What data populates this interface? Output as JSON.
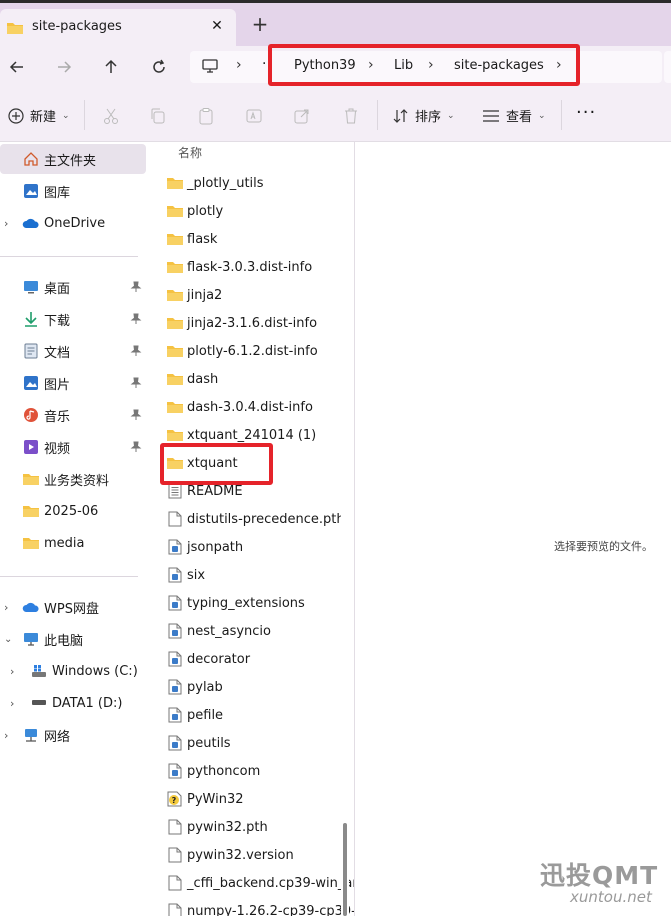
{
  "window": {
    "tab_title": "site-packages"
  },
  "address": {
    "crumbs": [
      "Python39",
      "Lib",
      "site-packages"
    ]
  },
  "toolbar": {
    "new_label": "新建",
    "sort_label": "排序",
    "view_label": "查看"
  },
  "sidebar": {
    "home": "主文件夹",
    "gallery": "图库",
    "onedrive": "OneDrive",
    "quick": [
      {
        "label": "桌面",
        "icon": "desktop-icon"
      },
      {
        "label": "下载",
        "icon": "download-icon"
      },
      {
        "label": "文档",
        "icon": "documents-icon"
      },
      {
        "label": "图片",
        "icon": "pictures-icon"
      },
      {
        "label": "音乐",
        "icon": "music-icon"
      },
      {
        "label": "视频",
        "icon": "videos-icon"
      }
    ],
    "folders": [
      "业务类资料",
      "2025-06",
      "media"
    ],
    "wps": "WPS网盘",
    "thispc": "此电脑",
    "drive_c": "Windows (C:)",
    "drive_d": "DATA1 (D:)",
    "network": "网络"
  },
  "filelist": {
    "column_name": "名称",
    "items": [
      {
        "name": "_plotly_utils",
        "type": "folder"
      },
      {
        "name": "plotly",
        "type": "folder"
      },
      {
        "name": "flask",
        "type": "folder"
      },
      {
        "name": "flask-3.0.3.dist-info",
        "type": "folder"
      },
      {
        "name": "jinja2",
        "type": "folder"
      },
      {
        "name": "jinja2-3.1.6.dist-info",
        "type": "folder"
      },
      {
        "name": "plotly-6.1.2.dist-info",
        "type": "folder"
      },
      {
        "name": "dash",
        "type": "folder"
      },
      {
        "name": "dash-3.0.4.dist-info",
        "type": "folder"
      },
      {
        "name": "xtquant_241014 (1)",
        "type": "folder"
      },
      {
        "name": "xtquant",
        "type": "folder"
      },
      {
        "name": "README",
        "type": "text"
      },
      {
        "name": "distutils-precedence.pth",
        "type": "file"
      },
      {
        "name": "jsonpath",
        "type": "pyfile"
      },
      {
        "name": "six",
        "type": "pyfile"
      },
      {
        "name": "typing_extensions",
        "type": "pyfile"
      },
      {
        "name": "nest_asyncio",
        "type": "pyfile"
      },
      {
        "name": "decorator",
        "type": "pyfile"
      },
      {
        "name": "pylab",
        "type": "pyfile"
      },
      {
        "name": "pefile",
        "type": "pyfile"
      },
      {
        "name": "peutils",
        "type": "pyfile"
      },
      {
        "name": "pythoncom",
        "type": "pyfile"
      },
      {
        "name": "PyWin32",
        "type": "help"
      },
      {
        "name": "pywin32.pth",
        "type": "file"
      },
      {
        "name": "pywin32.version",
        "type": "file"
      },
      {
        "name": "_cffi_backend.cp39-win_an",
        "type": "file"
      },
      {
        "name": "numpy-1.26.2-cp39-cp39-",
        "type": "file"
      }
    ]
  },
  "preview": {
    "message": "选择要预览的文件。"
  },
  "watermark": {
    "line1": "迅投QMT",
    "line2": "xuntou.net"
  },
  "colors": {
    "highlight": "#e5232a",
    "folder": "#f5c242",
    "tabbar": "#e4d5ea"
  }
}
